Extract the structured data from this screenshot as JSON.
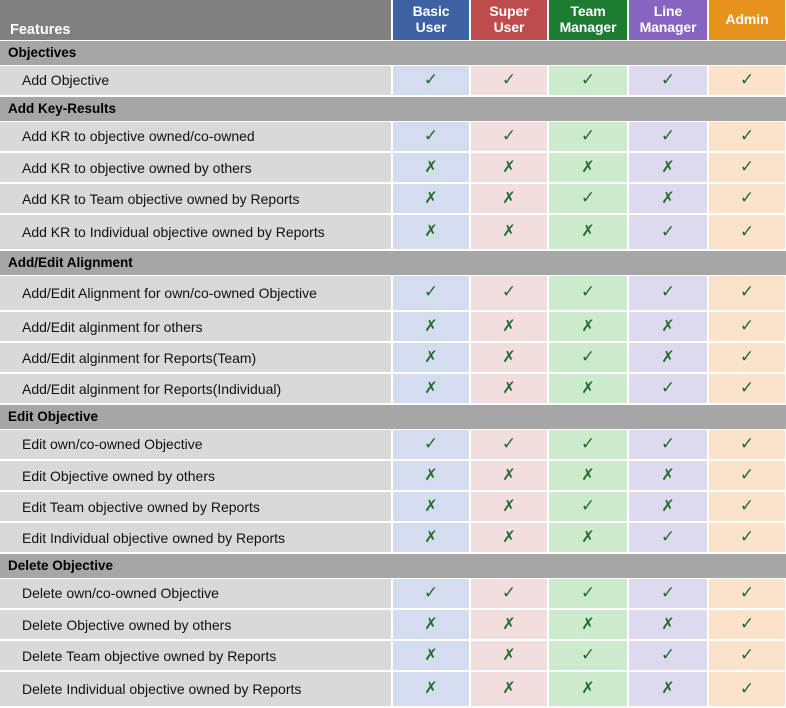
{
  "table": {
    "features_header": "Features",
    "roles": [
      {
        "id": "basic_user",
        "lines": [
          "Basic",
          "User"
        ],
        "header_color": "#3c62a3",
        "cell_color": "#d4ddf0"
      },
      {
        "id": "super_user",
        "lines": [
          "Super",
          "User"
        ],
        "header_color": "#bf4c4c",
        "cell_color": "#f2dede"
      },
      {
        "id": "team_manager",
        "lines": [
          "Team",
          "Manager"
        ],
        "header_color": "#1e7b32",
        "cell_color": "#ccebcc"
      },
      {
        "id": "line_manager",
        "lines": [
          "Line",
          "Manager"
        ],
        "header_color": "#8664c0",
        "cell_color": "#ddd9ee"
      },
      {
        "id": "admin",
        "lines": [
          "Admin"
        ],
        "header_color": "#e8921e",
        "cell_color": "#fbe2cb"
      }
    ],
    "marks": {
      "yes": "✓",
      "no": "✗"
    },
    "sections": [
      {
        "title": "Objectives",
        "rows": [
          {
            "label": "Add Objective",
            "values": [
              "yes",
              "yes",
              "yes",
              "yes",
              "yes"
            ]
          }
        ]
      },
      {
        "title": "Add Key-Results",
        "rows": [
          {
            "label": "Add KR to objective owned/co-owned",
            "values": [
              "yes",
              "yes",
              "yes",
              "yes",
              "yes"
            ]
          },
          {
            "label": "Add KR to objective owned by others",
            "values": [
              "no",
              "no",
              "no",
              "no",
              "yes"
            ]
          },
          {
            "label": "Add KR to Team objective owned by Reports",
            "values": [
              "no",
              "no",
              "yes",
              "no",
              "yes"
            ]
          },
          {
            "label": "Add KR to Individual objective owned by Reports",
            "values": [
              "no",
              "no",
              "no",
              "yes",
              "yes"
            ]
          }
        ]
      },
      {
        "title": "Add/Edit Alignment",
        "rows": [
          {
            "label": "Add/Edit Alignment for own/co-owned Objective",
            "values": [
              "yes",
              "yes",
              "yes",
              "yes",
              "yes"
            ]
          },
          {
            "label": "Add/Edit alginment for others",
            "values": [
              "no",
              "no",
              "no",
              "no",
              "yes"
            ]
          },
          {
            "label": "Add/Edit alginment for Reports(Team)",
            "values": [
              "no",
              "no",
              "yes",
              "no",
              "yes"
            ]
          },
          {
            "label": "Add/Edit alginment for Reports(Individual)",
            "values": [
              "no",
              "no",
              "no",
              "yes",
              "yes"
            ]
          }
        ]
      },
      {
        "title": "Edit Objective",
        "rows": [
          {
            "label": "Edit own/co-owned Objective",
            "values": [
              "yes",
              "yes",
              "yes",
              "yes",
              "yes"
            ]
          },
          {
            "label": "Edit Objective owned by others",
            "values": [
              "no",
              "no",
              "no",
              "no",
              "yes"
            ]
          },
          {
            "label": "Edit Team objective owned by Reports",
            "values": [
              "no",
              "no",
              "yes",
              "no",
              "yes"
            ]
          },
          {
            "label": "Edit Individual objective owned by Reports",
            "values": [
              "no",
              "no",
              "no",
              "yes",
              "yes"
            ]
          }
        ]
      },
      {
        "title": "Delete Objective",
        "rows": [
          {
            "label": "Delete own/co-owned Objective",
            "values": [
              "yes",
              "yes",
              "yes",
              "yes",
              "yes"
            ]
          },
          {
            "label": "Delete Objective owned by others",
            "values": [
              "no",
              "no",
              "no",
              "no",
              "yes"
            ]
          },
          {
            "label": "Delete Team objective owned by Reports",
            "values": [
              "no",
              "no",
              "yes",
              "yes",
              "yes"
            ]
          },
          {
            "label": "Delete Individual objective owned by Reports",
            "values": [
              "no",
              "no",
              "no",
              "no",
              "yes"
            ]
          }
        ]
      }
    ]
  }
}
